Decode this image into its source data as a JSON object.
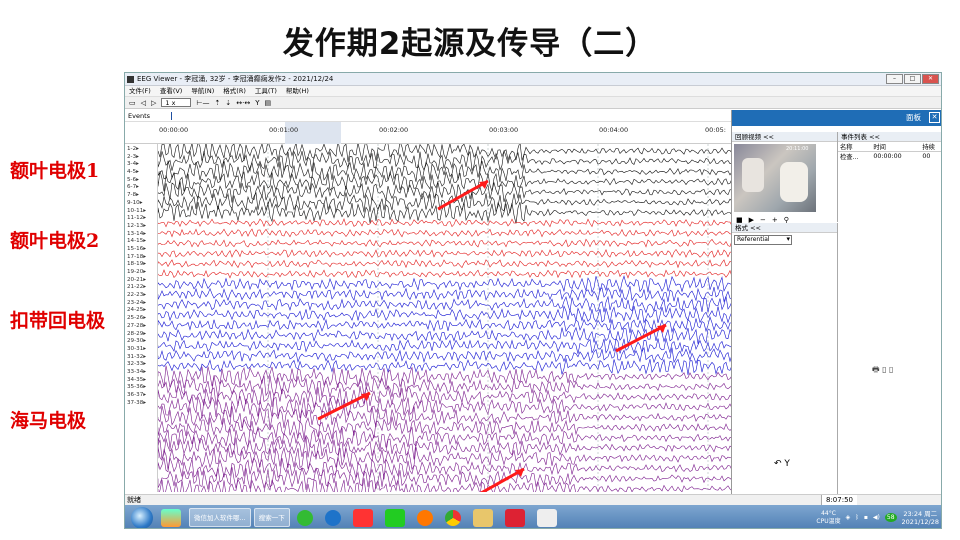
{
  "slide": {
    "title": "发作期2起源及传导（二）",
    "side_labels": [
      "额叶电极1",
      "额叶电极2",
      "扣带回电极",
      "海马电极"
    ]
  },
  "window": {
    "title": "EEG Viewer - 李冠涌, 32岁 - 李冠涌癫痫发作2 - 2021/12/24"
  },
  "menu": [
    "文件(F)",
    "查看(V)",
    "导航(N)",
    "格式(R)",
    "工具(T)",
    "帮助(H)"
  ],
  "toolbar": {
    "speed": "1 x"
  },
  "events_row_label": "Events",
  "time_ticks": [
    "00:00:00",
    "00:01:00",
    "00:02:00",
    "00:03:00",
    "00:04:00",
    "00:05:"
  ],
  "channels": [
    "1-2",
    "2-3",
    "3-4",
    "4-5",
    "5-6",
    "6-7",
    "7-8",
    "9-10",
    "10-11",
    "11-12",
    "12-13",
    "13-14",
    "14-15",
    "15-16",
    "17-18",
    "18-19",
    "19-20",
    "20-21",
    "21-22",
    "22-23",
    "23-24",
    "24-25",
    "25-26",
    "27-28",
    "28-29",
    "29-30",
    "30-31",
    "31-32",
    "32-33",
    "33-34",
    "34-35",
    "35-36",
    "36-37",
    "37-38"
  ],
  "colors": {
    "black_group": "#111111",
    "red_group": "#e21c1c",
    "blue_group": "#1414d2",
    "purple_group": "#7a1a8c",
    "arrow": "#ff1a1a",
    "panel_header": "#1f6db6"
  },
  "right_panel": {
    "header": "面板",
    "video_title": "回顾视频 <<",
    "video_timestamp": "20:11:00",
    "events_title": "事件列表 <<",
    "events_columns": [
      "名称",
      "时间",
      "持续"
    ],
    "events_rows": [
      [
        "检查...",
        "00:00:00",
        "00"
      ]
    ],
    "format_title": "格式 <<",
    "format_value": "Referential"
  },
  "statusbar": {
    "left": "就绪",
    "right": "8:07:50"
  },
  "taskbar": {
    "tasks": [
      "微信加人软件哪...",
      "搜索一下"
    ],
    "weather": "44°C",
    "cpu_label": "CPU温度",
    "time": "23:24 周二",
    "date": "2021/12/28",
    "badge": "58"
  }
}
